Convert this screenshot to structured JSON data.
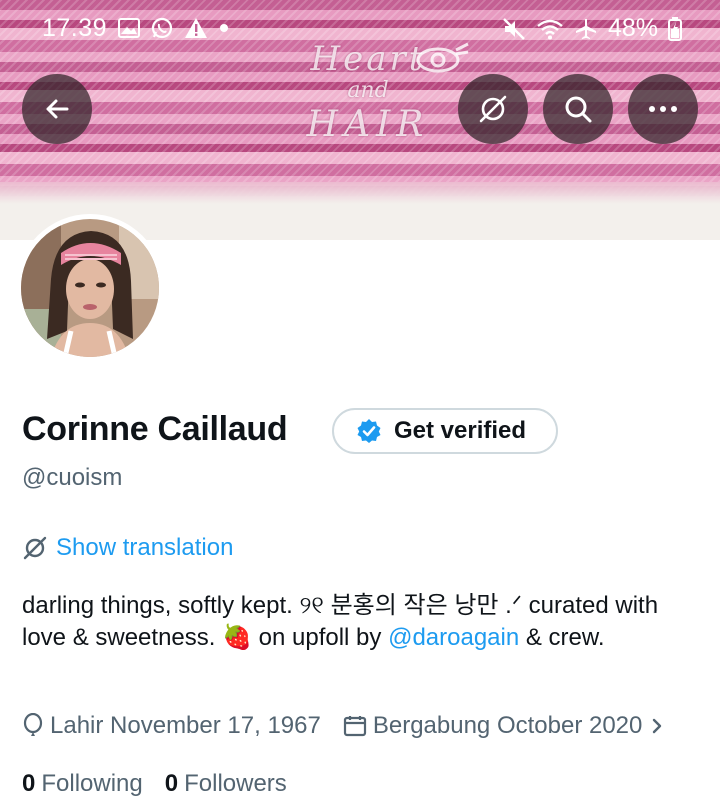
{
  "status_bar": {
    "time": "17.39",
    "battery": "48%",
    "left_icons": [
      "image-icon",
      "whatsapp-icon",
      "warning-icon",
      "dot-icon"
    ],
    "right_icons": [
      "mute-icon",
      "wifi-icon",
      "airplane-icon",
      "battery-icon"
    ]
  },
  "banner": {
    "art_line1": "Heart",
    "art_line2": "and",
    "art_line3": "HAIR"
  },
  "header": {
    "back_icon": "arrow-left-icon",
    "translate_icon": "translate-icon",
    "search_icon": "search-icon",
    "more_icon": "more-horizontal-icon"
  },
  "profile": {
    "display_name": "Corinne Caillaud",
    "verify_label": "Get verified",
    "handle": "@cuoism",
    "show_translation": "Show translation",
    "bio_part1": "darling things, softly kept. ୨୧ 분홍의 작은 낭만 .ᐟ curated with love & sweetness. 🍓 on upfoll by ",
    "bio_mention": "@daroagain",
    "bio_part2": " & crew.",
    "birth": "Lahir November 17, 1967",
    "joined": "Bergabung October 2020",
    "following_count": "0",
    "following_label": "Following",
    "followers_count": "0",
    "followers_label": "Followers"
  },
  "colors": {
    "accent": "#1d9bf0",
    "secondary_text": "#536471",
    "primary_text": "#0f1419",
    "banner_pink": "#c45f93"
  }
}
